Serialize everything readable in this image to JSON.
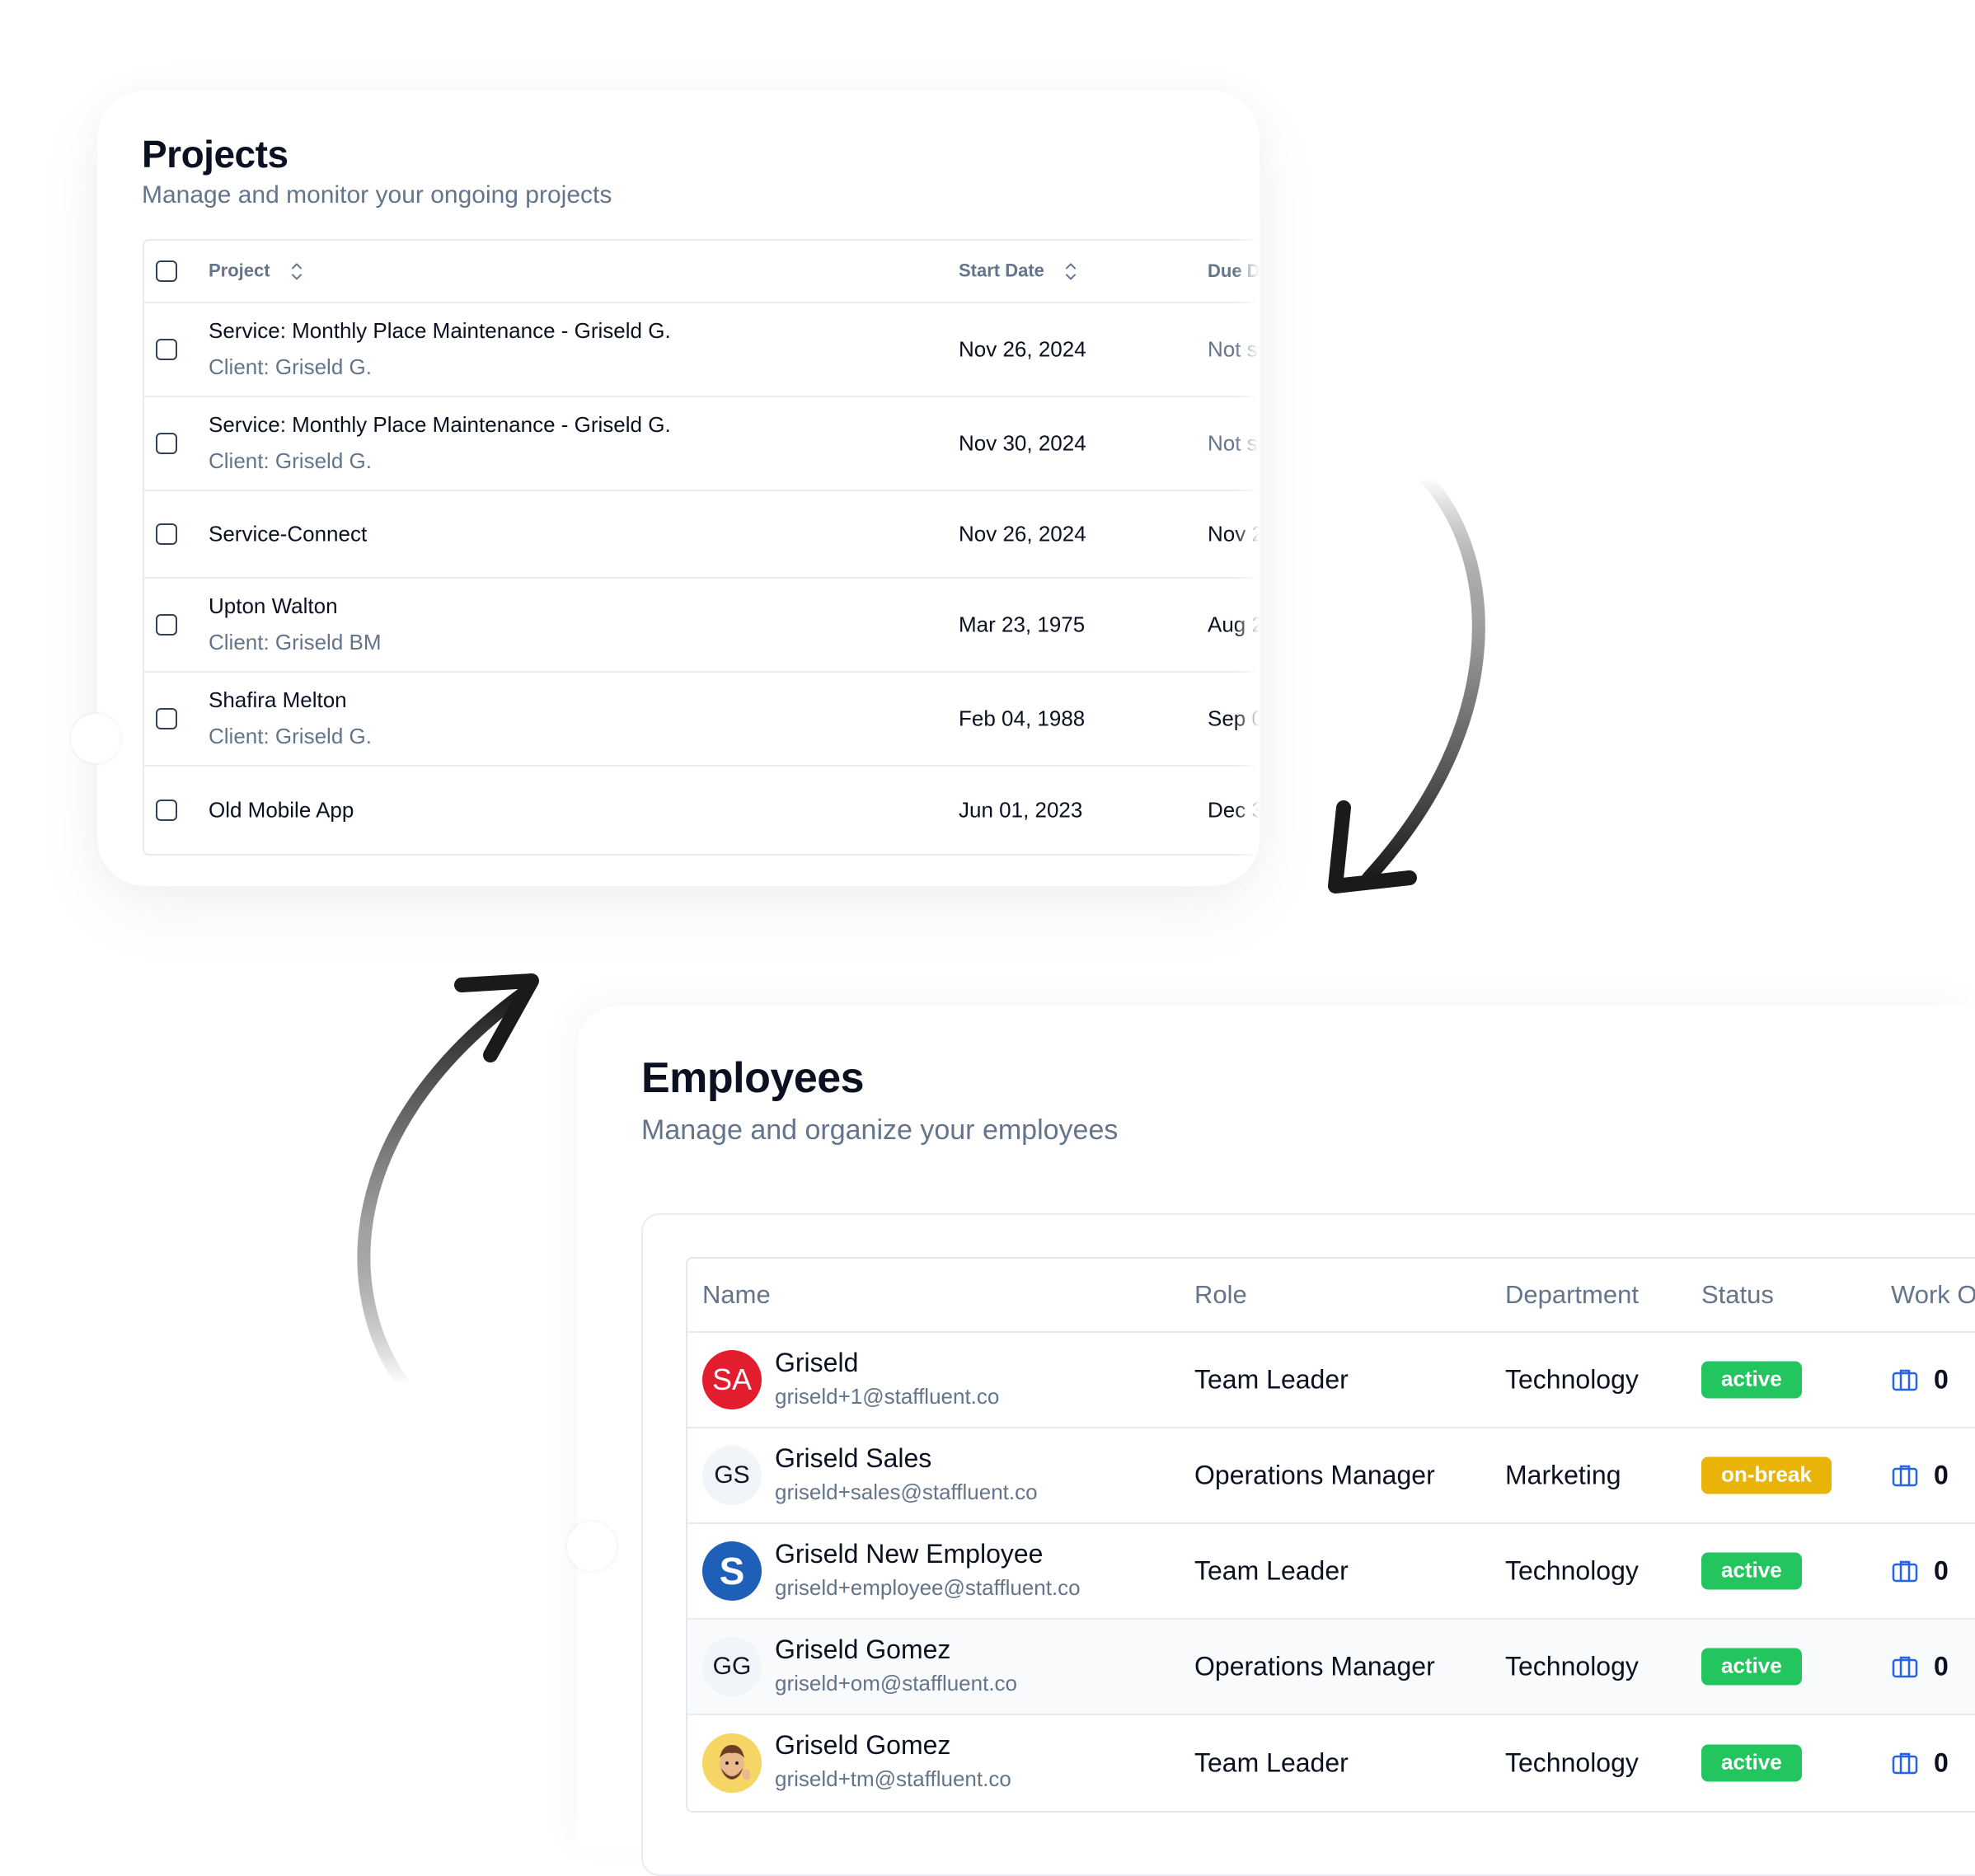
{
  "projects": {
    "title": "Projects",
    "subtitle": "Manage and monitor your ongoing projects",
    "columns": {
      "project": "Project",
      "start_date": "Start Date",
      "due_date": "Due D"
    },
    "rows": [
      {
        "name": "Service: Monthly Place Maintenance - Griseld G.",
        "client": "Client: Griseld G.",
        "start": "Nov 26, 2024",
        "due": "Not s"
      },
      {
        "name": "Service: Monthly Place Maintenance - Griseld G.",
        "client": "Client: Griseld G.",
        "start": "Nov 30, 2024",
        "due": "Not s"
      },
      {
        "name": "Service-Connect",
        "client": "",
        "start": "Nov 26, 2024",
        "due": "Nov 2"
      },
      {
        "name": "Upton Walton",
        "client": "Client: Griseld BM",
        "start": "Mar 23, 1975",
        "due": "Aug 2"
      },
      {
        "name": "Shafira Melton",
        "client": "Client: Griseld G.",
        "start": "Feb 04, 1988",
        "due": "Sep 0"
      },
      {
        "name": "Old Mobile App",
        "client": "",
        "start": "Jun 01, 2023",
        "due": "Dec 3"
      }
    ]
  },
  "employees": {
    "title": "Employees",
    "subtitle": "Manage and organize your employees",
    "columns": {
      "name": "Name",
      "role": "Role",
      "department": "Department",
      "status": "Status",
      "work": "Work O"
    },
    "rows": [
      {
        "avatar": "SA",
        "avatar_style": "red",
        "name": "Griseld",
        "email": "griseld+1@staffluent.co",
        "role": "Team Leader",
        "department": "Technology",
        "status": "active",
        "work_orders": "0"
      },
      {
        "avatar": "GS",
        "avatar_style": "gray",
        "name": "Griseld Sales",
        "email": "griseld+sales@staffluent.co",
        "role": "Operations Manager",
        "department": "Marketing",
        "status": "on-break",
        "work_orders": "0"
      },
      {
        "avatar": "S",
        "avatar_style": "blue",
        "name": "Griseld New Employee",
        "email": "griseld+employee@staffluent.co",
        "role": "Team Leader",
        "department": "Technology",
        "status": "active",
        "work_orders": "0"
      },
      {
        "avatar": "GG",
        "avatar_style": "gray",
        "name": "Griseld Gomez",
        "email": "griseld+om@staffluent.co",
        "role": "Operations Manager",
        "department": "Technology",
        "status": "active",
        "work_orders": "0"
      },
      {
        "avatar": "",
        "avatar_style": "emoji",
        "name": "Griseld Gomez",
        "email": "griseld+tm@staffluent.co",
        "role": "Team Leader",
        "department": "Technology",
        "status": "active",
        "work_orders": "0"
      }
    ]
  },
  "colors": {
    "active": "#22c55e",
    "on_break": "#eab308",
    "muted_text": "#64748b",
    "work_icon": "#2563eb"
  },
  "icons": {
    "sort": "chevron-up-down-icon",
    "work": "briefcase-icon",
    "checkbox": "checkbox-icon"
  }
}
